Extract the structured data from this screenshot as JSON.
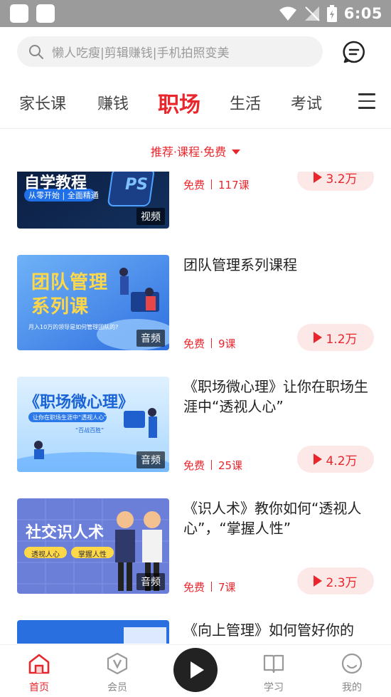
{
  "status_bar": {
    "time": "6:05"
  },
  "search": {
    "placeholder": "懒人吃瘦|剪辑赚钱|手机拍照变美"
  },
  "tabs": [
    {
      "label": "家长课"
    },
    {
      "label": "赚钱"
    },
    {
      "label": "职场",
      "active": true
    },
    {
      "label": "生活"
    },
    {
      "label": "考试"
    }
  ],
  "filter": {
    "label": "推荐·课程·免费"
  },
  "courses": [
    {
      "thumb_text": "自学教程",
      "thumb_sub": "从零开始 | 全面精通",
      "thumb_icon": "PS",
      "media": "视频",
      "title": "",
      "price": "免费",
      "lessons": "117课",
      "plays": "3.2万"
    },
    {
      "thumb_text": "团队管理系列课",
      "thumb_sub": "月入10万的领导是如何管理团队的?",
      "media": "音频",
      "title": "团队管理系列课程",
      "price": "免费",
      "lessons": "9课",
      "plays": "1.2万"
    },
    {
      "thumb_text": "《职场微心理》",
      "thumb_sub": "让你在职场生涯中“透视人心”",
      "thumb_sub2": "“百战百胜”",
      "media": "音频",
      "title": "《职场微心理》让你在职场生涯中“透视人心”",
      "price": "免费",
      "lessons": "25课",
      "plays": "4.2万"
    },
    {
      "thumb_text": "社交识人术",
      "thumb_tag1": "透视人心",
      "thumb_tag2": "掌握人性",
      "media": "音频",
      "title": "《识人术》教你如何“透视人心”，“掌握人性”",
      "price": "免费",
      "lessons": "7课",
      "plays": "2.3万"
    },
    {
      "title": "《向上管理》如何管好你的"
    }
  ],
  "bottom_nav": [
    {
      "label": "首页",
      "icon": "home-icon",
      "active": true
    },
    {
      "label": "会员",
      "icon": "vip-icon"
    },
    {
      "label": "学习",
      "icon": "book-icon"
    },
    {
      "label": "我的",
      "icon": "profile-icon"
    }
  ],
  "colors": {
    "accent": "#e8262c",
    "status_bar": "#9b9b9b",
    "play_pill_bg": "#fde8e8"
  }
}
